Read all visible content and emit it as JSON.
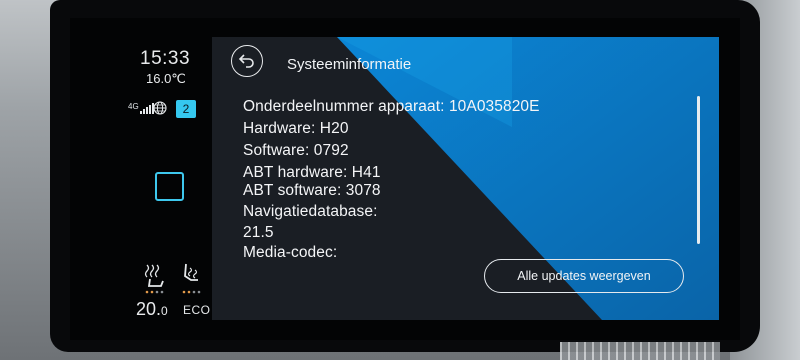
{
  "status": {
    "time": "15:33",
    "temperature": "16.0℃",
    "network": "4G",
    "notification_count": "2",
    "temp_setpoint_main": "20.",
    "temp_setpoint_decimal": "0",
    "eco_label": "ECO"
  },
  "header": {
    "title": "Systeeminformatie"
  },
  "info_lines": [
    "Onderdeelnummer apparaat: 10A035820E",
    "Hardware: H20",
    "Software: 0792",
    "ABT hardware: H41",
    "ABT software: 3078",
    "Navigatiedatabase:",
    "21.5",
    "Media-codec:"
  ],
  "actions": {
    "all_updates_label": "Alle updates weergeven"
  },
  "colors": {
    "accent": "#35c8ef",
    "panel_blue": "#0a78c8",
    "panel_dark": "#1a1e24"
  }
}
